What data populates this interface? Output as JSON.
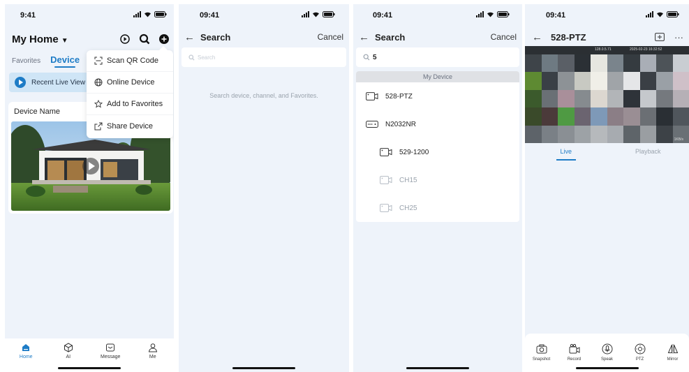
{
  "status_bar": {
    "time_screen1": "9:41",
    "time": "09:41"
  },
  "screen1": {
    "home_title": "My Home",
    "tabs": {
      "favorites": "Favorites",
      "device": "Device"
    },
    "recent_live_view": "Recent Live View",
    "device_card": {
      "name": "Device Name"
    },
    "add_menu": {
      "items": [
        {
          "label": "Scan QR Code",
          "icon": "scan-qr-icon"
        },
        {
          "label": "Online Device",
          "icon": "globe-icon"
        },
        {
          "label": "Add to Favorites",
          "icon": "star-icon"
        },
        {
          "label": "Share Device",
          "icon": "share-icon"
        }
      ]
    },
    "tabbar": {
      "home": "Home",
      "ai": "AI",
      "message": "Message",
      "me": "Me"
    }
  },
  "screen2": {
    "title": "Search",
    "cancel": "Cancel",
    "search_placeholder": "Search",
    "hint": "Search device, channel, and Favorites."
  },
  "screen3": {
    "title": "Search",
    "cancel": "Cancel",
    "search_value": "5",
    "section_header": "My Device",
    "results": [
      {
        "label": "528-PTZ",
        "level": 1,
        "online": true,
        "icon": "camera-icon"
      },
      {
        "label": "N2032NR",
        "level": 1,
        "online": true,
        "icon": "nvr-icon"
      },
      {
        "label": "529-1200",
        "level": 2,
        "online": true,
        "icon": "camera-icon"
      },
      {
        "label": "CH15",
        "level": 2,
        "online": false,
        "icon": "camera-icon"
      },
      {
        "label": "CH25",
        "level": 2,
        "online": false,
        "icon": "camera-icon"
      }
    ]
  },
  "screen4": {
    "title": "528-PTZ",
    "tabs": {
      "live": "Live",
      "playback": "Playback"
    },
    "controls": {
      "snapshot": "Snapshot",
      "record": "Record",
      "speak": "Speak",
      "ptz": "PTZ",
      "mirror": "Mirror"
    }
  },
  "colors": {
    "accent": "#1e7cc6",
    "background": "#eef3fa",
    "card": "#ffffff"
  }
}
